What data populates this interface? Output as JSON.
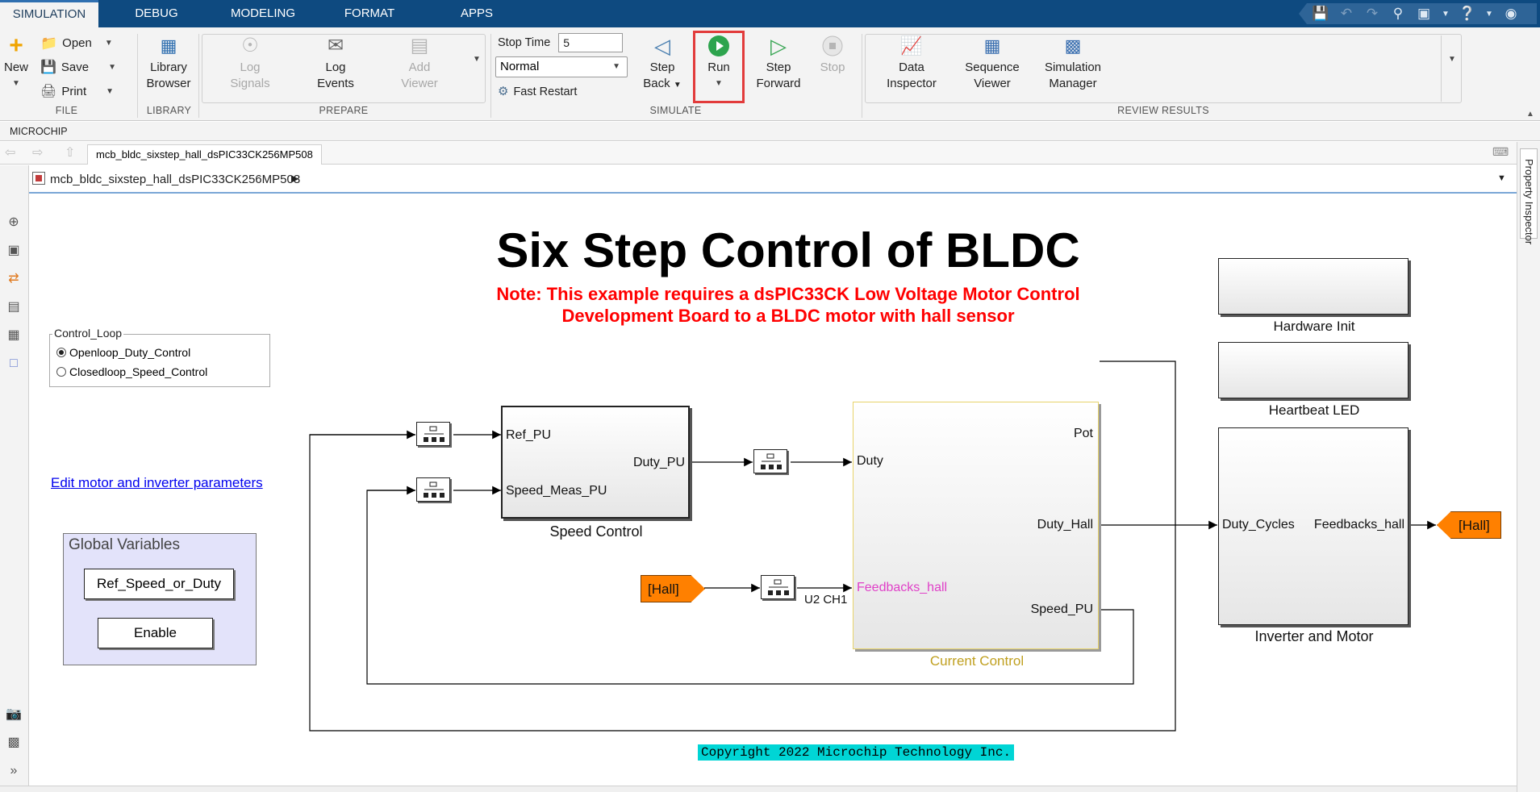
{
  "tabs": [
    "SIMULATION",
    "DEBUG",
    "MODELING",
    "FORMAT",
    "APPS"
  ],
  "ribbon": {
    "file": {
      "label": "FILE",
      "new": "New",
      "open": "Open",
      "save": "Save",
      "print": "Print"
    },
    "library": {
      "label": "LIBRARY",
      "browser_line1": "Library",
      "browser_line2": "Browser"
    },
    "prepare": {
      "label": "PREPARE",
      "log_signals_1": "Log",
      "log_signals_2": "Signals",
      "log_events_1": "Log",
      "log_events_2": "Events",
      "add_viewer_1": "Add",
      "add_viewer_2": "Viewer"
    },
    "simulate": {
      "label": "SIMULATE",
      "stop_time_label": "Stop Time",
      "stop_time_value": "5",
      "mode": "Normal",
      "fast_restart": "Fast Restart",
      "step_back_1": "Step",
      "step_back_2": "Back",
      "run": "Run",
      "step_forward_1": "Step",
      "step_forward_2": "Forward",
      "stop": "Stop"
    },
    "review": {
      "label": "REVIEW RESULTS",
      "data_inspector_1": "Data",
      "data_inspector_2": "Inspector",
      "sequence_viewer_1": "Sequence",
      "sequence_viewer_2": "Viewer",
      "sim_manager_1": "Simulation",
      "sim_manager_2": "Manager"
    }
  },
  "microchip_tab": "MICROCHIP",
  "document_tab": "mcb_bldc_sixstep_hall_dsPIC33CK256MP508",
  "breadcrumb": "mcb_bldc_sixstep_hall_dsPIC33CK256MP508",
  "property_inspector": "Property Inspector",
  "model": {
    "title": "Six Step Control of BLDC",
    "note_line1": "Note: This example requires a dsPIC33CK Low Voltage Motor Control",
    "note_line2": "Development Board to a BLDC motor with hall sensor",
    "control_loop": {
      "title": "Control_Loop",
      "options": [
        "Openloop_Duty_Control",
        "Closedloop_Speed_Control"
      ],
      "selected": "Openloop_Duty_Control"
    },
    "edit_link": "Edit motor and inverter parameters",
    "global_vars": {
      "title": "Global Variables",
      "ref_speed": "Ref_Speed_or_Duty",
      "enable": "Enable"
    },
    "speed_control": {
      "name": "Speed Control",
      "in1": "Ref_PU",
      "in2": "Speed_Meas_PU",
      "out1": "Duty_PU"
    },
    "current_control": {
      "name": "Current Control",
      "in1": "Duty",
      "in2": "Feedbacks_hall",
      "out1": "Pot",
      "out2": "Duty_Hall",
      "out3": "Speed_PU"
    },
    "inverter": {
      "name": "Inverter and Motor",
      "in1": "Duty_Cycles",
      "out1": "Feedbacks_hall"
    },
    "hardware_init": "Hardware Init",
    "heartbeat_led": "Heartbeat LED",
    "hall_from": "[Hall]",
    "hall_goto": "[Hall]",
    "rt_label": "U2 CH1",
    "copyright": "Copyright 2022 Microchip Technology Inc."
  },
  "colors": {
    "toolbar_blue": "#0e4a80",
    "run_highlight": "#e23b3b",
    "tag_orange": "#ff8000",
    "note_red": "#ff0000",
    "current_control_border": "#e8d36a",
    "feedbacks_magenta": "#e040c8",
    "copyright_bg": "#00d5d5"
  }
}
